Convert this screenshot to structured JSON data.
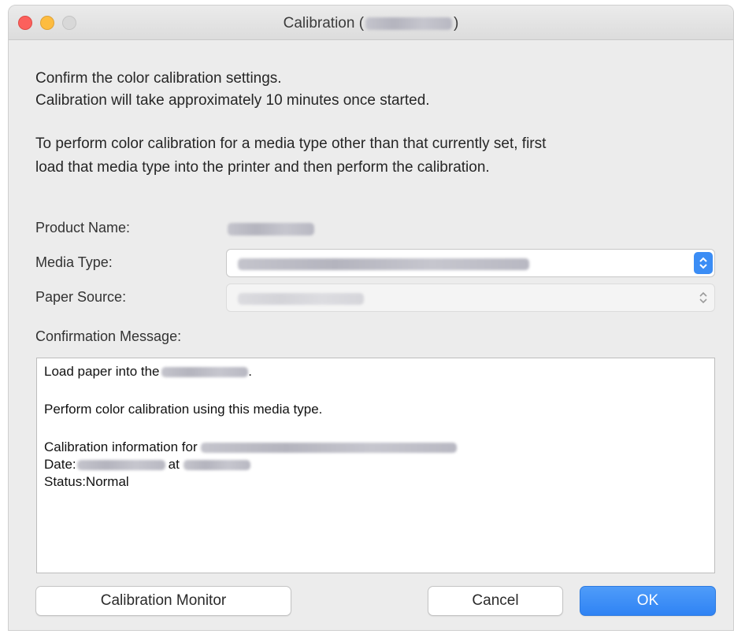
{
  "window": {
    "title_prefix": "Calibration (",
    "title_suffix": ")"
  },
  "intro": {
    "line1": "Confirm the color calibration settings.",
    "line2": "Calibration will take approximately 10 minutes once started.",
    "line3": "To perform color calibration for a media type other than that currently set, first",
    "line4": "load that media type into the printer and then perform the calibration."
  },
  "form": {
    "product_name_label": "Product Name:",
    "media_type_label": "Media Type:",
    "paper_source_label": "Paper Source:",
    "confirmation_label": "Confirmation Message:"
  },
  "message": {
    "load_prefix": "Load paper into the",
    "load_suffix": ".",
    "perform": "Perform color calibration using this media type.",
    "info_prefix": "Calibration information for",
    "date_label": " Date:",
    "date_at": "at",
    "status": " Status:Normal"
  },
  "buttons": {
    "calibration_monitor": "Calibration Monitor",
    "cancel": "Cancel",
    "ok": "OK"
  },
  "colors": {
    "accent": "#3b8df5",
    "close": "#fc605c",
    "minimize": "#fdbc40"
  }
}
